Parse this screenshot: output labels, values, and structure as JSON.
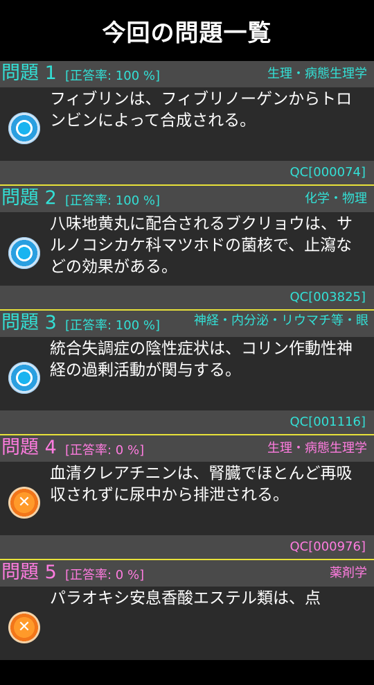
{
  "header": {
    "title": "今回の問題一覧"
  },
  "items": [
    {
      "title": "問題 1",
      "rate": "[正答率: 100 %]",
      "category": "生理・病態生理学",
      "text": "フィブリンは、フィブリノーゲンからトロンビンによって合成される。",
      "code": "QC[000074]",
      "result": "correct",
      "icon": "correct-icon"
    },
    {
      "title": "問題 2",
      "rate": "[正答率: 100 %]",
      "category": "化学・物理",
      "text": "八味地黄丸に配合されるブクリョウは、サルノコシカケ科マツホドの菌核で、止瀉などの効果がある。",
      "code": "QC[003825]",
      "result": "correct",
      "icon": "correct-icon"
    },
    {
      "title": "問題 3",
      "rate": "[正答率: 100 %]",
      "category": "神経・内分泌・リウマチ等・眼",
      "text": "統合失調症の陰性症状は、コリン作動性神経の過剰活動が関与する。",
      "code": "QC[001116]",
      "result": "correct",
      "icon": "correct-icon"
    },
    {
      "title": "問題 4",
      "rate": "[正答率: 0 %]",
      "category": "生理・病態生理学",
      "text": "血清クレアチニンは、腎臓でほとんど再吸収されずに尿中から排泄される。",
      "code": "QC[000976]",
      "result": "wrong",
      "icon": "wrong-icon"
    },
    {
      "title": "問題 5",
      "rate": "[正答率: 0 %]",
      "category": "薬剤学",
      "text": "パラオキシ安息香酸エステル類は、点",
      "code": "",
      "result": "wrong",
      "icon": "wrong-icon"
    }
  ],
  "colors": {
    "correct_text": "#33e0d6",
    "wrong_text": "#ff7ce0",
    "separator": "#e8e23a",
    "header_bg": "#4a4a4a",
    "body_bg": "#2b2b2b"
  }
}
